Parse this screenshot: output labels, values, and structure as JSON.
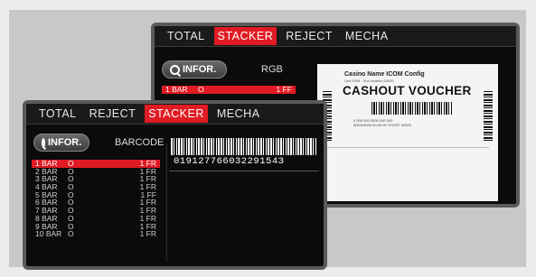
{
  "back_screen": {
    "tabs": [
      "TOTAL",
      "STACKER",
      "REJECT",
      "MECHA"
    ],
    "active_tab": "STACKER",
    "infor_button": "INFOR.",
    "mode_label": "RGB",
    "selected_row": {
      "num": "1 BAR",
      "mark": "O",
      "code": "1 FF"
    },
    "voucher": {
      "header_line": "Casino Name ICOM Config",
      "sub_line": "Unit 0098 · Slot location 00000",
      "title": "CASHOUT VOUCHER",
      "fine_print": [
        "0 000 000 0000 000 000",
        "00/00/0000 00:00:00 TICKET #0000"
      ]
    }
  },
  "front_screen": {
    "tabs": [
      "TOTAL",
      "REJECT",
      "STACKER",
      "MECHA"
    ],
    "active_tab": "STACKER",
    "infor_button": "INFOR.",
    "mode_label": "BARCODE",
    "barcode_value": "01912776603229154З",
    "rows": [
      {
        "num": "1 BAR",
        "mark": "O",
        "code": "1 FR"
      },
      {
        "num": "2 BAR",
        "mark": "O",
        "code": "1 FR"
      },
      {
        "num": "3 BAR",
        "mark": "O",
        "code": "1 FR"
      },
      {
        "num": "4 BAR",
        "mark": "O",
        "code": "1 FR"
      },
      {
        "num": "5 BAR",
        "mark": "O",
        "code": "1 FF"
      },
      {
        "num": "6 BAR",
        "mark": "O",
        "code": "1 FR"
      },
      {
        "num": "7 BAR",
        "mark": "O",
        "code": "1 FR"
      },
      {
        "num": "8 BAR",
        "mark": "O",
        "code": "1 FR"
      },
      {
        "num": "9 BAR",
        "mark": "O",
        "code": "1 FR"
      },
      {
        "num": "10 BAR",
        "mark": "O",
        "code": "1 FR"
      }
    ],
    "selected_index": 0
  },
  "colors": {
    "accent": "#e01b24",
    "screen_bg": "#0b0b0b",
    "bezel": "#5a5a5a"
  }
}
